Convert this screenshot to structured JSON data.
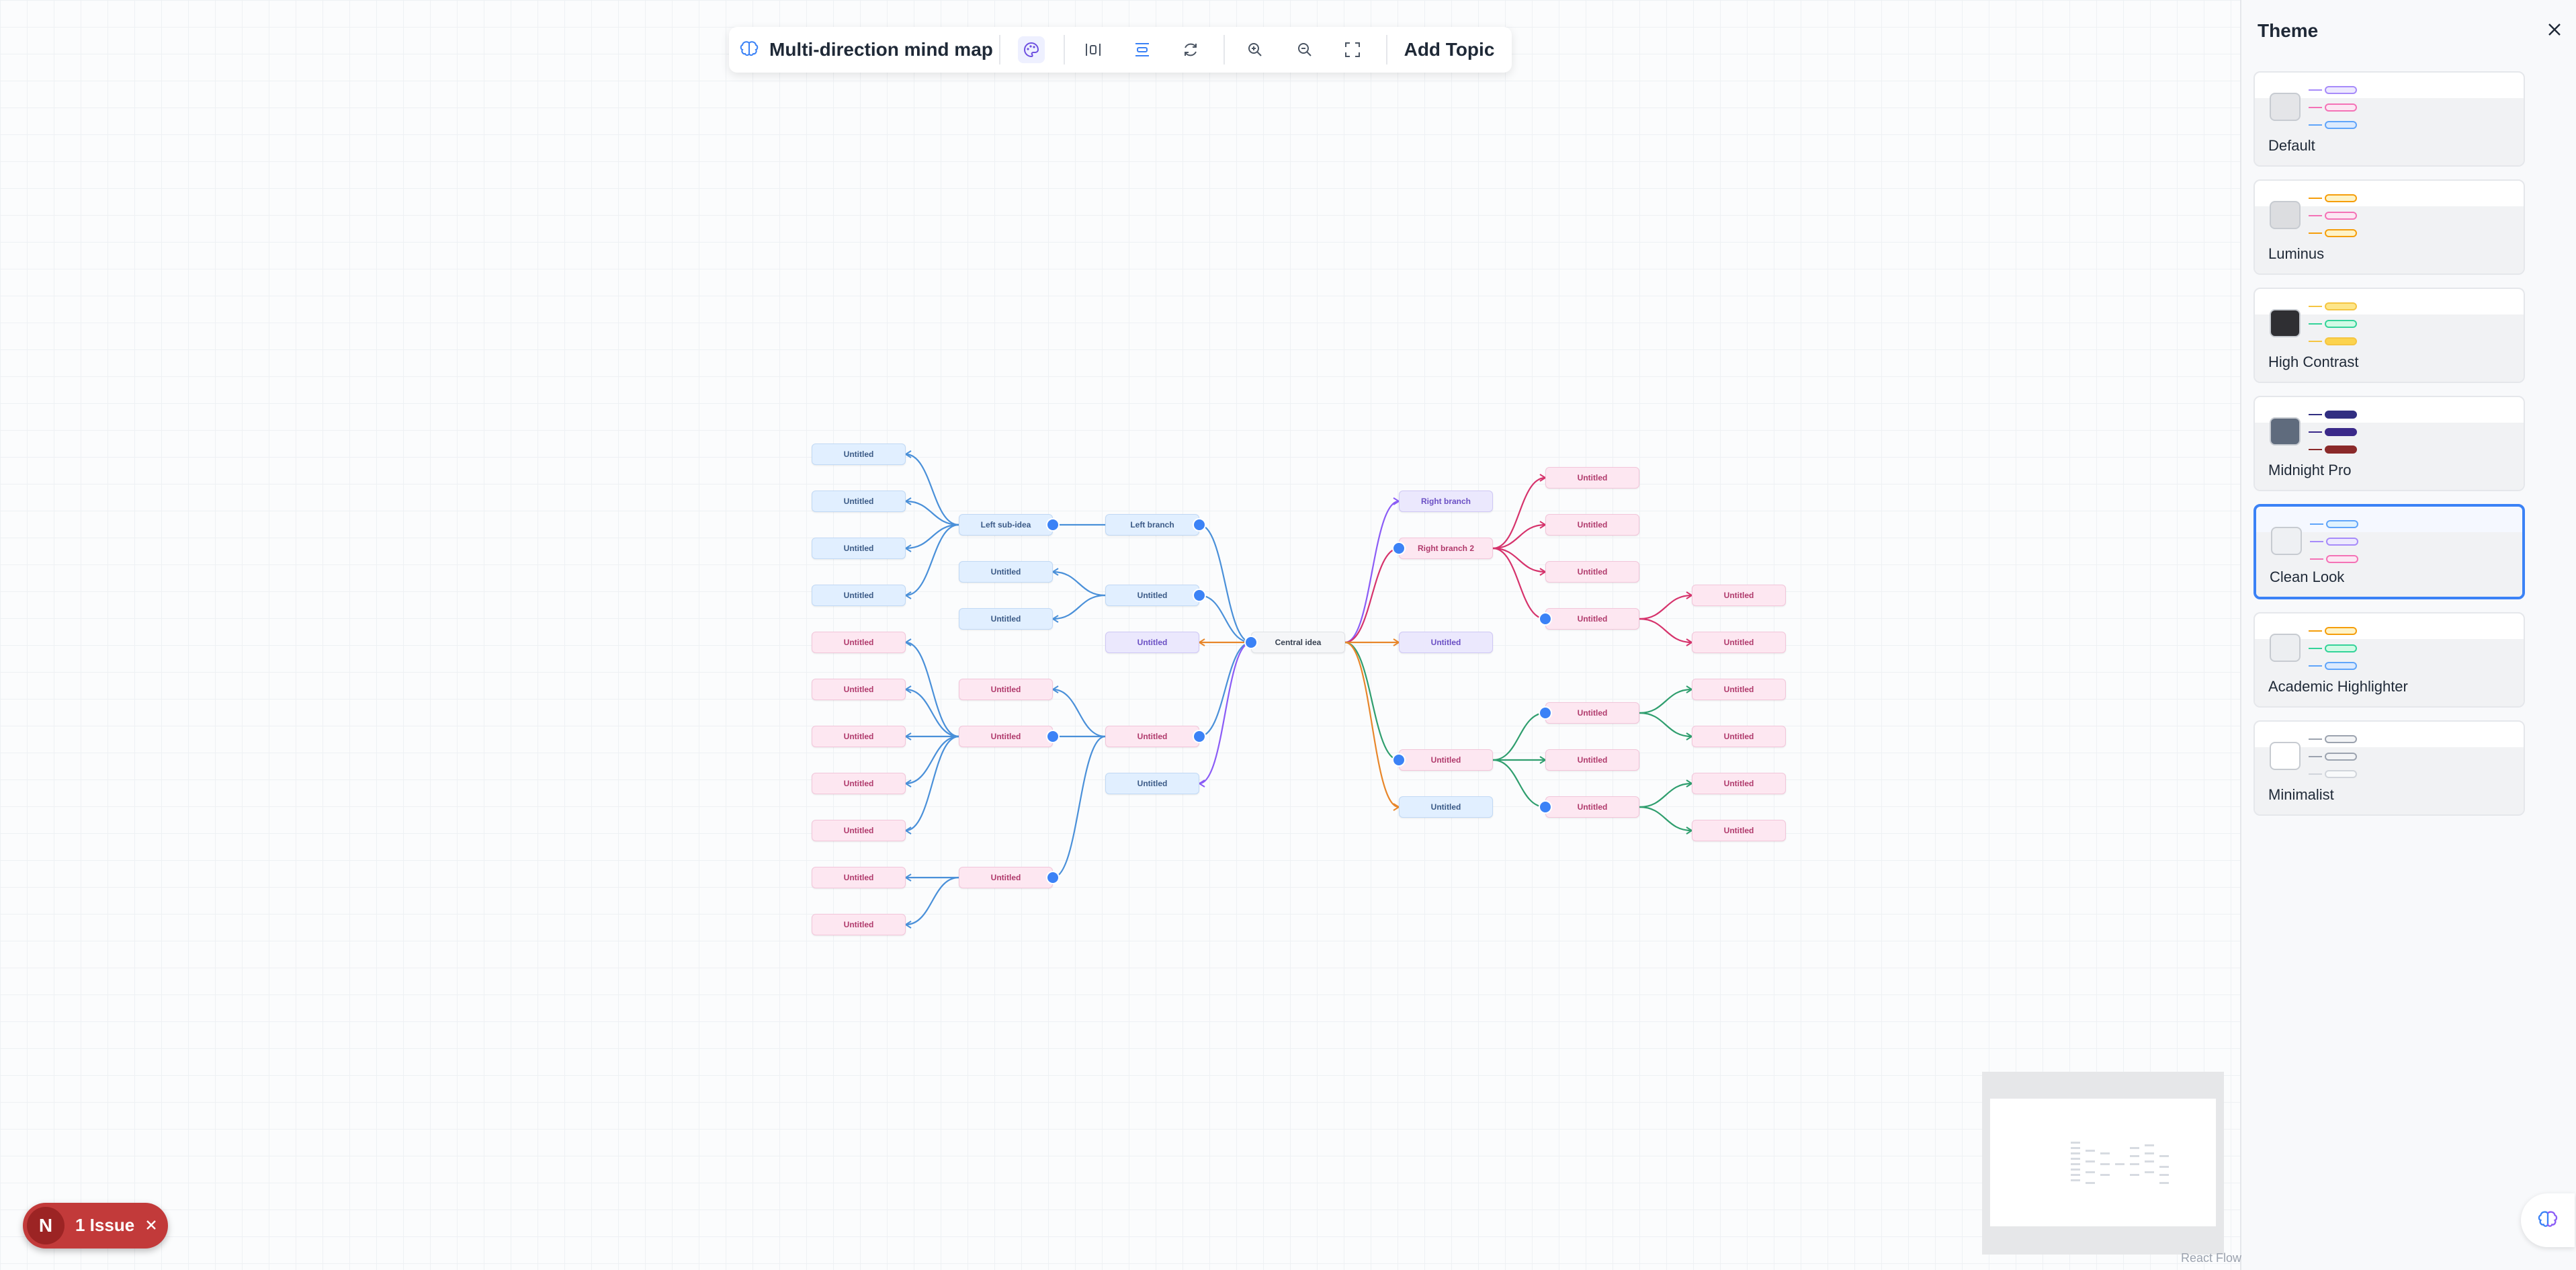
{
  "toolbar": {
    "title": "Multi-direction mind map",
    "add_topic_label": "Add Topic",
    "icons": [
      "brain-logo-icon",
      "palette-icon",
      "layout-horizontal-icon",
      "layout-vertical-icon",
      "refresh-icon",
      "zoom-in-icon",
      "zoom-out-icon",
      "fit-view-icon"
    ]
  },
  "mindmap": {
    "nodes": [
      {
        "id": "c",
        "label": "Central idea",
        "style": "center"
      },
      {
        "id": "lb",
        "label": "Left branch",
        "style": "blue"
      },
      {
        "id": "lsi",
        "label": "Left sub-idea",
        "style": "blue"
      },
      {
        "id": "lsi1",
        "label": "Untitled",
        "style": "blue"
      },
      {
        "id": "lsi2",
        "label": "Untitled",
        "style": "blue"
      },
      {
        "id": "lsi3",
        "label": "Untitled",
        "style": "blue"
      },
      {
        "id": "lsi4",
        "label": "Untitled",
        "style": "blue"
      },
      {
        "id": "l2",
        "label": "Untitled",
        "style": "blue"
      },
      {
        "id": "l2a",
        "label": "Untitled",
        "style": "blue"
      },
      {
        "id": "l2b",
        "label": "Untitled",
        "style": "blue"
      },
      {
        "id": "l3",
        "label": "Untitled",
        "style": "purple"
      },
      {
        "id": "l4",
        "label": "Untitled",
        "style": "pink"
      },
      {
        "id": "l4a",
        "label": "Untitled",
        "style": "pink"
      },
      {
        "id": "l4b",
        "label": "Untitled",
        "style": "pink"
      },
      {
        "id": "l4b1",
        "label": "Untitled",
        "style": "pink"
      },
      {
        "id": "l4b2",
        "label": "Untitled",
        "style": "pink"
      },
      {
        "id": "l4b3",
        "label": "Untitled",
        "style": "pink"
      },
      {
        "id": "l4b4",
        "label": "Untitled",
        "style": "pink"
      },
      {
        "id": "l4b5",
        "label": "Untitled",
        "style": "pink"
      },
      {
        "id": "l4c",
        "label": "Untitled",
        "style": "pink"
      },
      {
        "id": "l4c1",
        "label": "Untitled",
        "style": "pink"
      },
      {
        "id": "l4c2",
        "label": "Untitled",
        "style": "pink"
      },
      {
        "id": "l5",
        "label": "Untitled",
        "style": "blue"
      },
      {
        "id": "rb",
        "label": "Right branch",
        "style": "purple"
      },
      {
        "id": "rb2",
        "label": "Right branch 2",
        "style": "pink"
      },
      {
        "id": "rb2a",
        "label": "Untitled",
        "style": "pink"
      },
      {
        "id": "rb2b",
        "label": "Untitled",
        "style": "pink"
      },
      {
        "id": "rb2c",
        "label": "Untitled",
        "style": "pink"
      },
      {
        "id": "rb2d",
        "label": "Untitled",
        "style": "pink"
      },
      {
        "id": "rb2d1",
        "label": "Untitled",
        "style": "pink"
      },
      {
        "id": "rb2d2",
        "label": "Untitled",
        "style": "pink"
      },
      {
        "id": "r3",
        "label": "Untitled",
        "style": "purple"
      },
      {
        "id": "r4",
        "label": "Untitled",
        "style": "pink"
      },
      {
        "id": "r4a",
        "label": "Untitled",
        "style": "pink"
      },
      {
        "id": "r4a1",
        "label": "Untitled",
        "style": "pink"
      },
      {
        "id": "r4a2",
        "label": "Untitled",
        "style": "pink"
      },
      {
        "id": "r4b",
        "label": "Untitled",
        "style": "pink"
      },
      {
        "id": "r4c",
        "label": "Untitled",
        "style": "pink"
      },
      {
        "id": "r4c1",
        "label": "Untitled",
        "style": "pink"
      },
      {
        "id": "r4c2",
        "label": "Untitled",
        "style": "pink"
      },
      {
        "id": "r5",
        "label": "Untitled",
        "style": "blue"
      }
    ],
    "edges": [
      [
        "c",
        "lb",
        "#4a90d9"
      ],
      [
        "lb",
        "lsi",
        "#4a90d9"
      ],
      [
        "lsi",
        "lsi1",
        "#4a90d9"
      ],
      [
        "lsi",
        "lsi2",
        "#4a90d9"
      ],
      [
        "lsi",
        "lsi3",
        "#4a90d9"
      ],
      [
        "lsi",
        "lsi4",
        "#4a90d9"
      ],
      [
        "c",
        "l2",
        "#4a90d9"
      ],
      [
        "l2",
        "l2a",
        "#4a90d9"
      ],
      [
        "l2",
        "l2b",
        "#4a90d9"
      ],
      [
        "c",
        "l3",
        "#e8862a"
      ],
      [
        "c",
        "l4",
        "#4a90d9"
      ],
      [
        "l4",
        "l4a",
        "#4a90d9"
      ],
      [
        "l4",
        "l4b",
        "#4a90d9"
      ],
      [
        "l4",
        "l4c",
        "#4a90d9"
      ],
      [
        "l4b",
        "l4b1",
        "#4a90d9"
      ],
      [
        "l4b",
        "l4b2",
        "#4a90d9"
      ],
      [
        "l4b",
        "l4b3",
        "#4a90d9"
      ],
      [
        "l4b",
        "l4b4",
        "#4a90d9"
      ],
      [
        "l4b",
        "l4b5",
        "#4a90d9"
      ],
      [
        "l4c",
        "l4c1",
        "#4a90d9"
      ],
      [
        "l4c",
        "l4c2",
        "#4a90d9"
      ],
      [
        "c",
        "l5",
        "#8b5cf6"
      ],
      [
        "c",
        "rb",
        "#8b5cf6"
      ],
      [
        "c",
        "rb2",
        "#d6336c"
      ],
      [
        "rb2",
        "rb2a",
        "#d6336c"
      ],
      [
        "rb2",
        "rb2b",
        "#d6336c"
      ],
      [
        "rb2",
        "rb2c",
        "#d6336c"
      ],
      [
        "rb2",
        "rb2d",
        "#d6336c"
      ],
      [
        "rb2d",
        "rb2d1",
        "#d6336c"
      ],
      [
        "rb2d",
        "rb2d2",
        "#d6336c"
      ],
      [
        "c",
        "r3",
        "#e8862a"
      ],
      [
        "c",
        "r4",
        "#2f9e6e"
      ],
      [
        "r4",
        "r4a",
        "#2f9e6e"
      ],
      [
        "r4",
        "r4b",
        "#2f9e6e"
      ],
      [
        "r4",
        "r4c",
        "#2f9e6e"
      ],
      [
        "r4a",
        "r4a1",
        "#2f9e6e"
      ],
      [
        "r4a",
        "r4a2",
        "#2f9e6e"
      ],
      [
        "r4c",
        "r4c1",
        "#2f9e6e"
      ],
      [
        "r4c",
        "r4c2",
        "#2f9e6e"
      ],
      [
        "c",
        "r5",
        "#e8862a"
      ]
    ]
  },
  "theme_panel": {
    "title": "Theme",
    "selected": "Clean Look",
    "themes": [
      {
        "name": "Default",
        "swatch": "#e4e5e8",
        "pills": [
          [
            "#a78bfa",
            "#ede9fe"
          ],
          [
            "#f472b6",
            "#fce7f3"
          ],
          [
            "#60a5fa",
            "#dbeafe"
          ]
        ]
      },
      {
        "name": "Luminus",
        "swatch": "#dcdde0",
        "pills": [
          [
            "#f59e0b",
            "#fef3c7"
          ],
          [
            "#f472b6",
            "#fce7f3"
          ],
          [
            "#f59e0b",
            "#fef3c7"
          ]
        ]
      },
      {
        "name": "High Contrast",
        "swatch": "#2f2f33",
        "pills": [
          [
            "#f5c542",
            "#fde68a"
          ],
          [
            "#34d399",
            "#d1fae5"
          ],
          [
            "#f5c542",
            "#fcd34d"
          ]
        ]
      },
      {
        "name": "Midnight Pro",
        "swatch": "#5f6b7d",
        "pills": [
          [
            "#312e81",
            "#312e81"
          ],
          [
            "#3b2a8a",
            "#3b2a8a"
          ],
          [
            "#8b2a2a",
            "#8b2a2a"
          ]
        ]
      },
      {
        "name": "Clean Look",
        "swatch": "#eef0f3",
        "pills": [
          [
            "#60a5fa",
            "#e0f2fe"
          ],
          [
            "#a78bfa",
            "#ede9fe"
          ],
          [
            "#f472b6",
            "#fce7f3"
          ]
        ]
      },
      {
        "name": "Academic Highlighter",
        "swatch": "#eceef1",
        "pills": [
          [
            "#f59e0b",
            "#fef3c7"
          ],
          [
            "#34d399",
            "#d1fae5"
          ],
          [
            "#60a5fa",
            "#dbeafe"
          ]
        ]
      },
      {
        "name": "Minimalist",
        "swatch": "#ffffff",
        "pills": [
          [
            "#9ca3af",
            "#f3f4f6"
          ],
          [
            "#9ca3af",
            "#f3f4f6"
          ],
          [
            "#d1d5db",
            "#f9fafb"
          ]
        ]
      }
    ]
  },
  "attribution": "React Flow",
  "issue_badge": {
    "icon_letter": "N",
    "text": "1 Issue"
  }
}
